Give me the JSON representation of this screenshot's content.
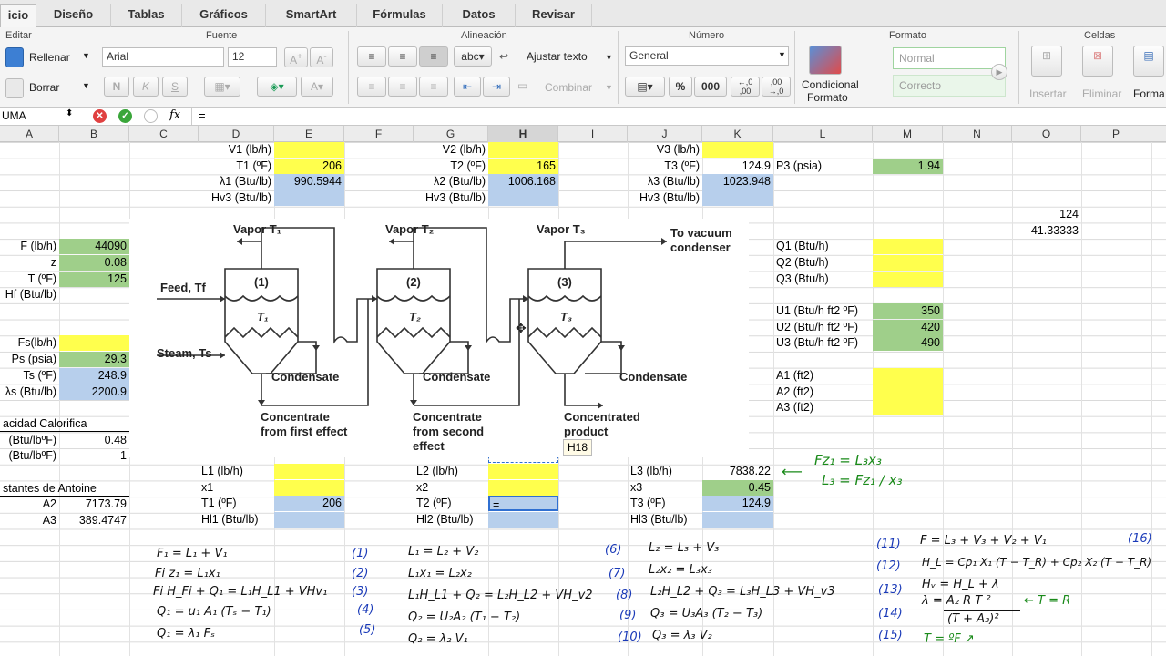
{
  "tabs": [
    "icio",
    "Diseño",
    "Tablas",
    "Gráficos",
    "SmartArt",
    "Fórmulas",
    "Datos",
    "Revisar"
  ],
  "ribbon": {
    "groups": [
      "Editar",
      "Fuente",
      "Alineación",
      "Número",
      "Formato",
      "Celdas"
    ],
    "fill_label": "Rellenar",
    "clear_label": "Borrar",
    "font_name": "Arial",
    "font_size": "12",
    "wrap_label": "Ajustar texto",
    "merge_label": "Combinar",
    "abc_label": "abc",
    "number_format": "General",
    "percent": "%",
    "thousands": "000",
    "dec_inc": "←,0 ,00",
    "dec_dec": ",00 →,0",
    "cond_format": "Condicional",
    "cond_format2": "Formato",
    "style_normal": "Normal",
    "style_correcto": "Correcto",
    "insert_label": "Insertar",
    "delete_label": "Eliminar",
    "format_label": "Forma"
  },
  "formula_bar": {
    "namebox": "UMA",
    "fx": "fx",
    "content": "="
  },
  "columns": [
    "A",
    "B",
    "C",
    "D",
    "E",
    "F",
    "G",
    "H",
    "I",
    "J",
    "K",
    "L",
    "M",
    "N",
    "O",
    "P"
  ],
  "cells": {
    "D1": "V1 (lb/h)",
    "D2": "T1 (ºF)",
    "E2": "206",
    "D3": "λ1 (Btu/lb)",
    "E3": "990.5944",
    "D4": "Hv3 (Btu/lb)",
    "G1": "V2 (lb/h)",
    "G2": "T2 (ºF)",
    "H2": "165",
    "G3": "λ2 (Btu/lb)",
    "H3": "1006.168",
    "G4": "Hv3 (Btu/lb)",
    "J1": "V3 (lb/h)",
    "J2": "T3 (ºF)",
    "K2": "124.9",
    "J3": "λ3 (Btu/lb)",
    "K3": "1023.948",
    "J4": "Hv3 (Btu/lb)",
    "L2": "P3 (psia)",
    "M2": "1.94",
    "O5": "124",
    "O6": "41.33333",
    "A7": "F (lb/h)",
    "B7": "44090",
    "A8": "z",
    "B8": "0.08",
    "A9": "T (ºF)",
    "B9": "125",
    "A10": "Hf (Btu/lb)",
    "L7": "Q1 (Btu/h)",
    "L8": "Q2 (Btu/h)",
    "L9": "Q3 (Btu/h)",
    "A12": "Fs(lb/h)",
    "A13": "Ps (psia)",
    "B13": "29.3",
    "A14": "Ts (ºF)",
    "B14": "248.9",
    "A15": "λs (Btu/lb)",
    "B15": "2200.9",
    "L11": "U1 (Btu/h ft2 ºF)",
    "M11": "350",
    "L12": "U2 (Btu/h ft2 ºF)",
    "M12": "420",
    "L13": "U3 (Btu/h ft2 ºF)",
    "M13": "490",
    "L15": "A1 (ft2)",
    "L16": "A2 (ft2)",
    "L17": "A3 (ft2)",
    "A17": "acidad Calorifica",
    "A18": "(Btu/lbºF)",
    "B18": "0.48",
    "A19": "(Btu/lbºF)",
    "B19": "1",
    "A21": "stantes de Antoine",
    "A22": "A2",
    "B22": "7173.79",
    "A23": "A3",
    "B23": "389.4747",
    "D21": "L1 (lb/h)",
    "D22": "x1",
    "D23": "T1 (ºF)",
    "E23": "206",
    "D24": "Hl1 (Btu/lb)",
    "G21": "L2 (lb/h)",
    "G22": "x2",
    "G23": "T2 (ºF)",
    "H23": "=",
    "G24": "Hl2 (Btu/lb)",
    "J21": "L3 (lb/h)",
    "K21": "7838.22",
    "J22": "x3",
    "K22": "0.45",
    "J23": "T3 (ºF)",
    "K23": "124.9",
    "J24": "Hl3 (Btu/lb)"
  },
  "tooltip": "H18",
  "diagram": {
    "vapor1": "Vapor T₁",
    "vapor2": "Vapor T₂",
    "vapor3": "Vapor T₃",
    "vacuum": "To vacuum condenser",
    "feed": "Feed, Tf",
    "steam": "Steam, Ts",
    "eff1": "(1)",
    "eff2": "(2)",
    "eff3": "(3)",
    "t1": "T₁",
    "t2": "T₂",
    "t3": "T₃",
    "condensate": "Condensate",
    "conc1": "Concentrate from first effect",
    "conc2": "Concentrate from second effect",
    "conc3": "Concentrated product"
  },
  "notes": {
    "green1": "Fz₁ = L₃x₃",
    "green2": "L₃ = Fz₁ / x₃",
    "eq1": "F₁ = L₁ + V₁",
    "n1": "(1)",
    "eq2": "Fi z₁ = L₁x₁",
    "n2": "(2)",
    "eq3": "Fi H_Fi + Q₁ = L₁H_L1 + VHv₁",
    "n3": "(3)",
    "eq4": "Q₁ = u₁ A₁ (Tₛ − T₁)",
    "n4": "(4)",
    "eq5": "Q₁ = λ₁ Fₛ",
    "n5": "(5)",
    "eq6": "L₁ = L₂ + V₂",
    "n6": "(6)",
    "eq7": "L₁x₁ = L₂x₂",
    "n7": "(7)",
    "eq8": "L₁H_L1 + Q₂ = L₂H_L2 + VH_v2",
    "n8": "(8)",
    "eq9": "Q₂ = U₂A₂ (T₁ − T₂)",
    "n9": "(9)",
    "eq10": "Q₂ = λ₂ V₁",
    "n10": "(10)",
    "eq6b": "L₂ = L₃ + V₃",
    "eq7b": "L₂x₂ = L₃x₃",
    "eq8b": "L₂H_L2 + Q₃ = L₃H_L3 + VH_v3",
    "eq9b": "Q₃ = U₃A₃ (T₂ − T₃)",
    "eq10b": "Q₃ = λ₃ V₂",
    "n11": "(11)",
    "eq11": "F = L₃ + V₃ + V₂ + V₁",
    "n16": "(16)",
    "n12": "(12)",
    "eq12": "H_L = Cp₁ X₁ (T − T_R) + Cp₂ X₂ (T − T_R)",
    "n13": "(13)",
    "eq13": "Hᵥ = H_L + λ",
    "n14": "(14)",
    "eq14a": "λ = A₂ R T ²",
    "eq14b": "(T + A₃)²",
    "eq14c": "← T = R",
    "n15": "(15)",
    "eq15": "T = ºF ↗"
  }
}
